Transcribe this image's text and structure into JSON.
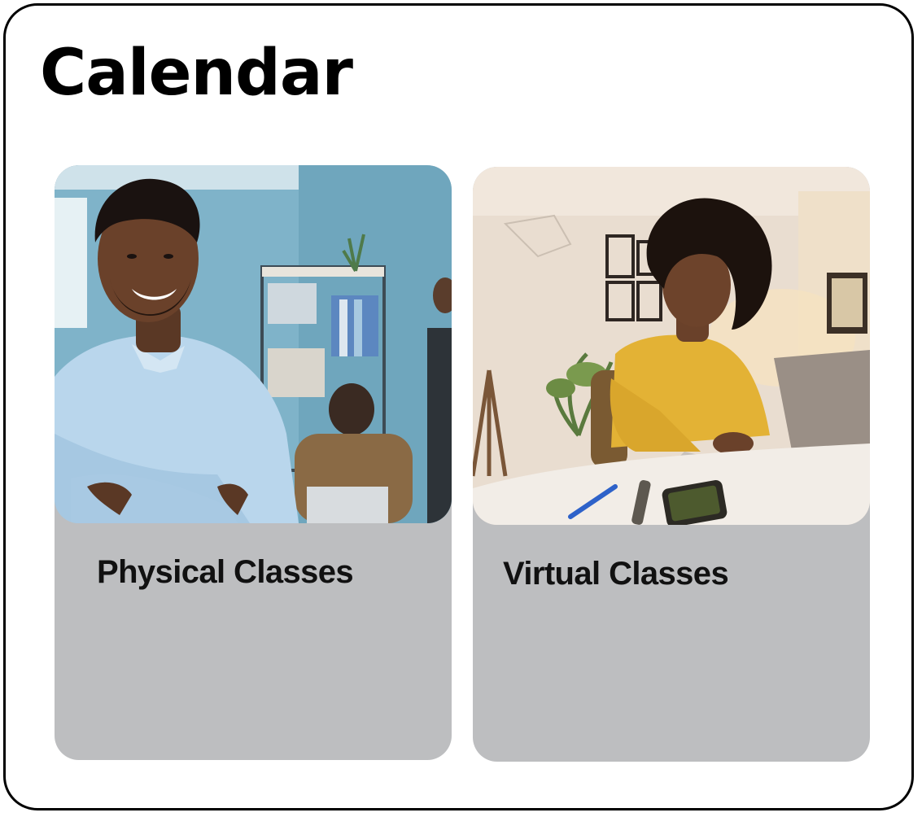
{
  "page": {
    "title": "Calendar"
  },
  "cards": [
    {
      "label": "Physical Classes",
      "image": "photo-smiling-man-office"
    },
    {
      "label": "Virtual Classes",
      "image": "photo-woman-laptop-home"
    }
  ],
  "colors": {
    "frame_border": "#000000",
    "card_background": "#bdbec0",
    "title_text": "#000000",
    "label_text": "#111111"
  }
}
